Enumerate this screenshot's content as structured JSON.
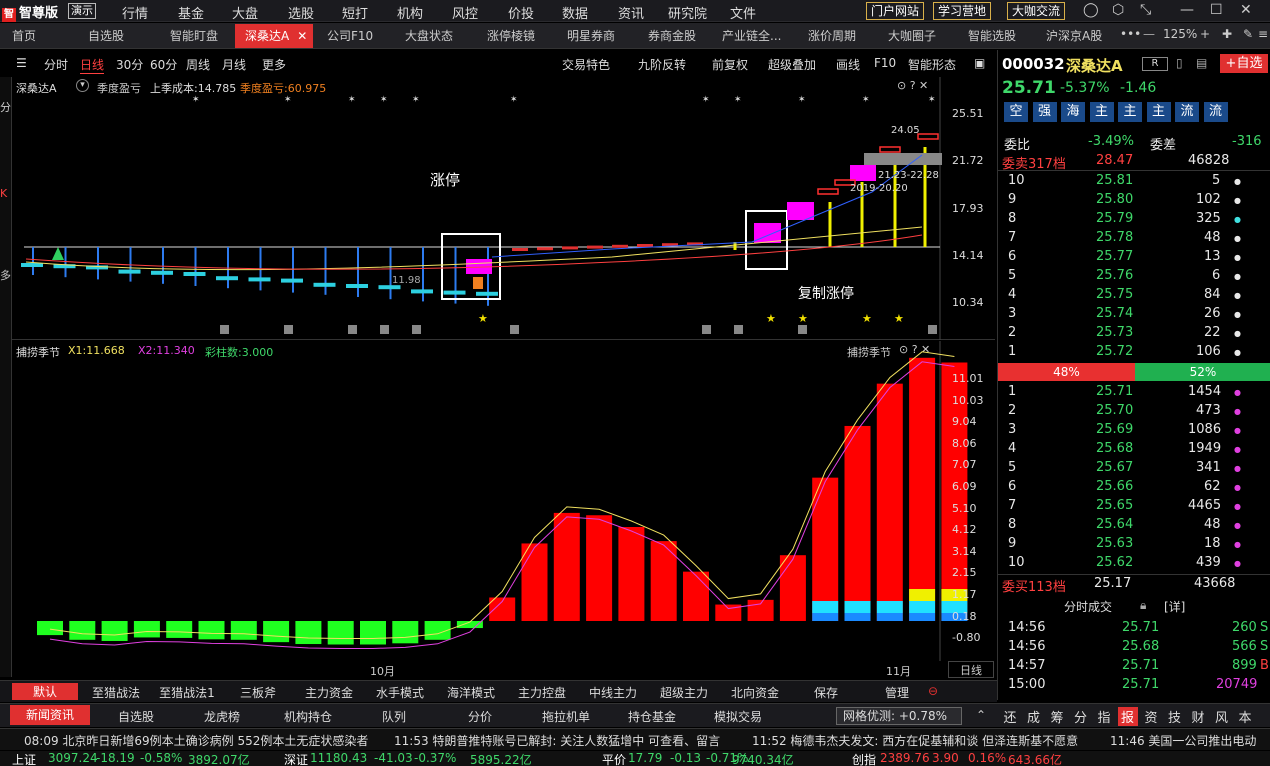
{
  "app": {
    "logo": "智尊版",
    "demo": "演示",
    "logo_mark": "智"
  },
  "menu": [
    "行情",
    "基金",
    "大盘",
    "选股",
    "短打",
    "机构",
    "风控",
    "价投",
    "数据",
    "资讯",
    "研究院",
    "文件"
  ],
  "top_buttons": [
    "门户网站",
    "学习营地",
    "大咖交流"
  ],
  "tabs": [
    "首页",
    "自选股",
    "智能盯盘",
    "深桑达A",
    "公司F10",
    "大盘状态",
    "涨停棱镜",
    "明星券商",
    "券商金股",
    "产业链全...",
    "涨价周期",
    "大咖圈子",
    "智能选股",
    "沪深京A股"
  ],
  "zoom": "125%",
  "chart_toolbar": {
    "left": [
      "分时",
      "日线",
      "30分",
      "60分",
      "周线",
      "月线",
      "更多"
    ],
    "right": [
      "交易特色",
      "九阶反转",
      "前复权",
      "超级叠加",
      "画线",
      "F10",
      "智能形态"
    ]
  },
  "chart_info": {
    "name": "深桑达A",
    "a": "季度盈亏",
    "b": "上季成本:14.785",
    "c": "季度盈亏:60.975"
  },
  "price_axis": [
    "25.51",
    "21.72",
    "17.93",
    "14.14",
    "10.34"
  ],
  "annotations": {
    "limit_up": "涨停",
    "copy_limit": "复制涨停",
    "p1": "24.05",
    "p2": "21.23-22.28",
    "p3": "2019-20.20",
    "p4": "11.98"
  },
  "indicator": {
    "name": "捕捞季节",
    "x1": "X1:11.668",
    "x2": "X2:11.340",
    "bars": "彩柱数:3.000",
    "title_right": "捕捞季节"
  },
  "ind_axis": [
    "11.01",
    "10.03",
    "9.04",
    "8.06",
    "7.07",
    "6.09",
    "5.10",
    "4.12",
    "3.14",
    "2.15",
    "1.17",
    "0.18",
    "-0.80"
  ],
  "x_labels": [
    "10月",
    "11月"
  ],
  "day_tag": "日线",
  "chart_data": {
    "type": "bar",
    "ind_values": [
      -0.6,
      -0.8,
      -0.85,
      -0.7,
      -0.72,
      -0.78,
      -0.8,
      -0.9,
      -0.98,
      -1.0,
      -1.0,
      -0.95,
      -0.8,
      -0.3,
      1.0,
      3.3,
      4.6,
      4.5,
      4.0,
      3.4,
      2.1,
      0.7,
      0.9,
      2.8,
      6.1,
      8.3,
      10.1,
      11.2,
      11.0
    ]
  },
  "right_panel": {
    "code": "000032",
    "name": "深桑达A",
    "badge": "R",
    "price": "25.71",
    "pct": "-5.37%",
    "chg": "-1.46",
    "tags": [
      "空",
      "强",
      "海",
      "主",
      "主",
      "主",
      "流",
      "流"
    ],
    "weibi_label": "委比",
    "weibi": "-3.49%",
    "weicha_label": "委差",
    "weicha": "-316",
    "sell_label": "委卖317档",
    "sell_px": "28.47",
    "sell_vol": "46828",
    "asks": [
      [
        "10",
        "25.81",
        "5"
      ],
      [
        "9",
        "25.80",
        "102"
      ],
      [
        "8",
        "25.79",
        "325"
      ],
      [
        "7",
        "25.78",
        "48"
      ],
      [
        "6",
        "25.77",
        "13"
      ],
      [
        "5",
        "25.76",
        "6"
      ],
      [
        "4",
        "25.75",
        "84"
      ],
      [
        "3",
        "25.74",
        "26"
      ],
      [
        "2",
        "25.73",
        "22"
      ],
      [
        "1",
        "25.72",
        "106"
      ]
    ],
    "ratio": [
      "48%",
      "52%"
    ],
    "bids": [
      [
        "1",
        "25.71",
        "1454"
      ],
      [
        "2",
        "25.70",
        "473"
      ],
      [
        "3",
        "25.69",
        "1086"
      ],
      [
        "4",
        "25.68",
        "1949"
      ],
      [
        "5",
        "25.67",
        "341"
      ],
      [
        "6",
        "25.66",
        "62"
      ],
      [
        "7",
        "25.65",
        "4465"
      ],
      [
        "8",
        "25.64",
        "48"
      ],
      [
        "9",
        "25.63",
        "18"
      ],
      [
        "10",
        "25.62",
        "439"
      ]
    ],
    "buy_label": "委买113档",
    "buy_px": "25.17",
    "buy_vol": "43668",
    "ticks_title": "分时成交",
    "ticks_detail": "[详]",
    "ticks": [
      [
        "14:56",
        "25.71",
        "260",
        "S"
      ],
      [
        "14:56",
        "25.68",
        "566",
        "S"
      ],
      [
        "14:57",
        "25.71",
        "899",
        "B"
      ],
      [
        "15:00",
        "25.71",
        "20749",
        ""
      ]
    ]
  },
  "bottom_tabs1": [
    "默认",
    "至猎战法",
    "至猎战法1",
    "三板斧",
    "主力资金",
    "水手模式",
    "海洋模式",
    "主力控盘",
    "中线主力",
    "超级主力",
    "北向资金",
    "保存",
    "管理"
  ],
  "bottom_tabs2": [
    "新闻资讯",
    "自选股",
    "龙虎榜",
    "机构持仓",
    "队列",
    "分价",
    "拖拉机单",
    "持仓基金",
    "模拟交易"
  ],
  "grid_opt": "网格优测: +0.78%",
  "right_tabs": [
    "还",
    "成",
    "筹",
    "分",
    "指",
    "报",
    "资",
    "技",
    "财",
    "风",
    "本"
  ],
  "news": [
    "08:09 北京昨日新增69例本土确诊病例 552例本土无症状感染者",
    "11:53 特朗普推特账号已解封: 关注人数猛增中 可查看、留言",
    "11:52 梅德韦杰夫发文: 西方在促基辅和谈 但泽连斯基不愿意",
    "11:46 美国一公司推出电动"
  ],
  "ticker": [
    "上证",
    "3097.24",
    "-18.19",
    "-0.58%",
    "3892.07亿",
    "深证",
    "11180.43",
    "-41.03",
    "-0.37%",
    "5895.22亿",
    "平价",
    "17.79",
    "-0.13",
    "-0.71%",
    "9740.34亿",
    "创指",
    "2389.76",
    "3.90",
    "0.16%",
    "643.66亿"
  ]
}
